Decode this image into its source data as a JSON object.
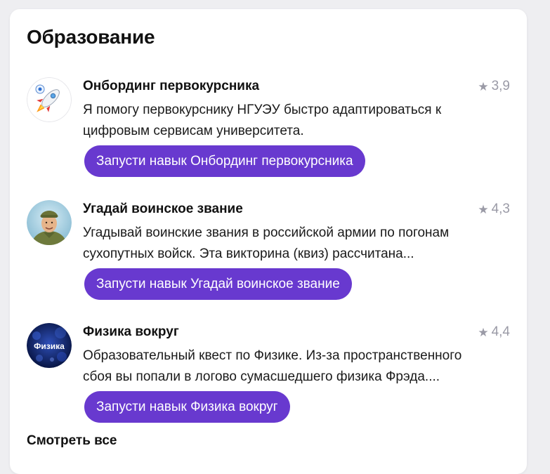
{
  "section": {
    "title": "Образование",
    "see_all_label": "Смотреть все"
  },
  "skills": [
    {
      "name": "Онбординг первокурсника",
      "rating": "3,9",
      "description": "Я помогу первокурснику НГУЭУ быстро адаптироваться к цифровым сервисам университета.",
      "button_label": "Запусти навык Онбординг первокурсника",
      "icon": "rocket-icon"
    },
    {
      "name": "Угадай воинское звание",
      "rating": "4,3",
      "description": "Угадывай воинские звания в российской армии по погонам сухопутных войск. Эта викторина (квиз) рассчитана...",
      "button_label": "Запусти навык Угадай воинское звание",
      "icon": "soldier-portrait-icon"
    },
    {
      "name": "Физика вокруг",
      "rating": "4,4",
      "description": "Образовательный квест по Физике. Из-за пространственного сбоя вы попали в логово сумасшедшего физика Фрэда....",
      "button_label": "Запусти навык Физика вокруг",
      "icon": "physics-logo-icon",
      "icon_text": "Физика"
    }
  ],
  "colors": {
    "accent": "#6839cf",
    "rating": "#9a9aa6",
    "card": "#ffffff",
    "background": "#eeeef1"
  }
}
